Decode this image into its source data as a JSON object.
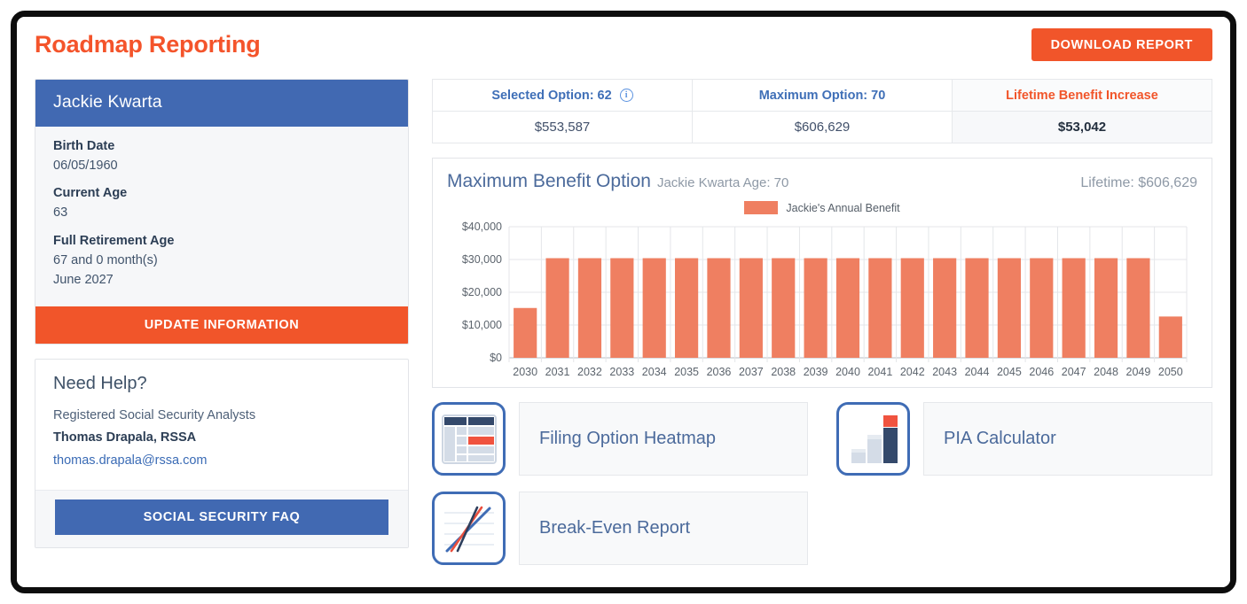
{
  "header": {
    "title": "Roadmap Reporting",
    "download_label": "DOWNLOAD REPORT"
  },
  "profile": {
    "name": "Jackie Kwarta",
    "fields": [
      {
        "label": "Birth Date",
        "value": "06/05/1960"
      },
      {
        "label": "Current Age",
        "value": "63"
      },
      {
        "label": "Full Retirement Age",
        "value": "67 and 0 month(s)",
        "value2": "June 2027"
      }
    ],
    "update_label": "UPDATE INFORMATION"
  },
  "help": {
    "title": "Need Help?",
    "org": "Registered Social Security Analysts",
    "advisor": "Thomas Drapala, RSSA",
    "email": "thomas.drapala@rssa.com",
    "faq_label": "SOCIAL SECURITY FAQ"
  },
  "summary": {
    "columns": [
      {
        "header": "Selected Option: 62",
        "has_info_icon": true,
        "value": "$553,587",
        "accent": false
      },
      {
        "header": "Maximum Option: 70",
        "has_info_icon": false,
        "value": "$606,629",
        "accent": false
      },
      {
        "header": "Lifetime Benefit Increase",
        "has_info_icon": false,
        "value": "$53,042",
        "accent": true
      }
    ]
  },
  "chart_panel": {
    "title": "Maximum Benefit Option",
    "subtitle": "Jackie Kwarta Age: 70",
    "lifetime": "Lifetime: $606,629"
  },
  "chart_data": {
    "type": "bar",
    "title": "Maximum Benefit Option",
    "subtitle": "Jackie Kwarta Age: 70",
    "xlabel": "",
    "ylabel": "",
    "ylim": [
      0,
      40000
    ],
    "yticks": [
      0,
      10000,
      20000,
      30000,
      40000
    ],
    "ytick_labels": [
      "$0",
      "$10,000",
      "$20,000",
      "$30,000",
      "$40,000"
    ],
    "grid": true,
    "legend": [
      "Jackie's Annual Benefit"
    ],
    "legend_position": "top-center",
    "bar_color": "#ef7f61",
    "categories": [
      "2030",
      "2031",
      "2032",
      "2033",
      "2034",
      "2035",
      "2036",
      "2037",
      "2038",
      "2039",
      "2040",
      "2041",
      "2042",
      "2043",
      "2044",
      "2045",
      "2046",
      "2047",
      "2048",
      "2049",
      "2050"
    ],
    "series": [
      {
        "name": "Jackie's Annual Benefit",
        "values": [
          15200,
          30400,
          30400,
          30400,
          30400,
          30400,
          30400,
          30400,
          30400,
          30400,
          30400,
          30400,
          30400,
          30400,
          30400,
          30400,
          30400,
          30400,
          30400,
          30400,
          12600
        ]
      }
    ]
  },
  "cards": [
    {
      "label": "Filing Option Heatmap",
      "icon": "table-heatmap-icon"
    },
    {
      "label": "PIA Calculator",
      "icon": "bar-chart-icon"
    },
    {
      "label": "Break-Even Report",
      "icon": "line-chart-icon"
    }
  ]
}
